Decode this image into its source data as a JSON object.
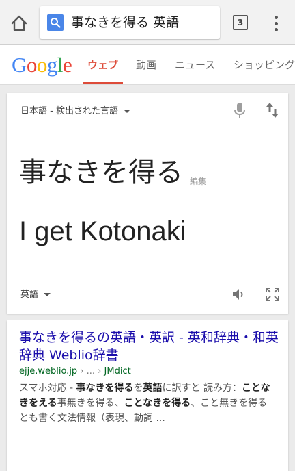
{
  "browser": {
    "query": "事なきを得る 英語",
    "tab_count": "3"
  },
  "google": {
    "logo_letters": [
      "G",
      "o",
      "o",
      "g",
      "l",
      "e"
    ],
    "tabs": [
      {
        "label": "ウェブ",
        "active": true
      },
      {
        "label": "動画",
        "active": false
      },
      {
        "label": "ニュース",
        "active": false
      },
      {
        "label": "ショッピング",
        "active": false
      }
    ]
  },
  "translate": {
    "source_language": "日本語 - 検出された言語",
    "source_text": "事なきを得る",
    "edit_label": "編集",
    "translated_text": "I get Kotonaki",
    "target_language": "英語"
  },
  "result": {
    "title": "事なきを得るの英語・英訳 - 英和辞典・和英辞典 Weblio辞書",
    "url_domain": "ejje.weblio.jp",
    "url_sep": " › ... › ",
    "url_path": "JMdict",
    "snippet_parts": [
      {
        "text": "スマホ対応 - ",
        "bold": false
      },
      {
        "text": "事なきを得る",
        "bold": true
      },
      {
        "text": "を",
        "bold": false
      },
      {
        "text": "英語",
        "bold": true
      },
      {
        "text": "に訳すと 読み方：",
        "bold": false
      },
      {
        "text": "ことなきをえる",
        "bold": true
      },
      {
        "text": "事無きを得る、",
        "bold": false
      },
      {
        "text": "ことなきを得る",
        "bold": true
      },
      {
        "text": "、こと無きを得る とも書く文法情報（表現、動詞 ...",
        "bold": false
      }
    ]
  },
  "colors": {
    "accent": "#dd4b39",
    "link": "#1a0dab",
    "url": "#006621"
  }
}
